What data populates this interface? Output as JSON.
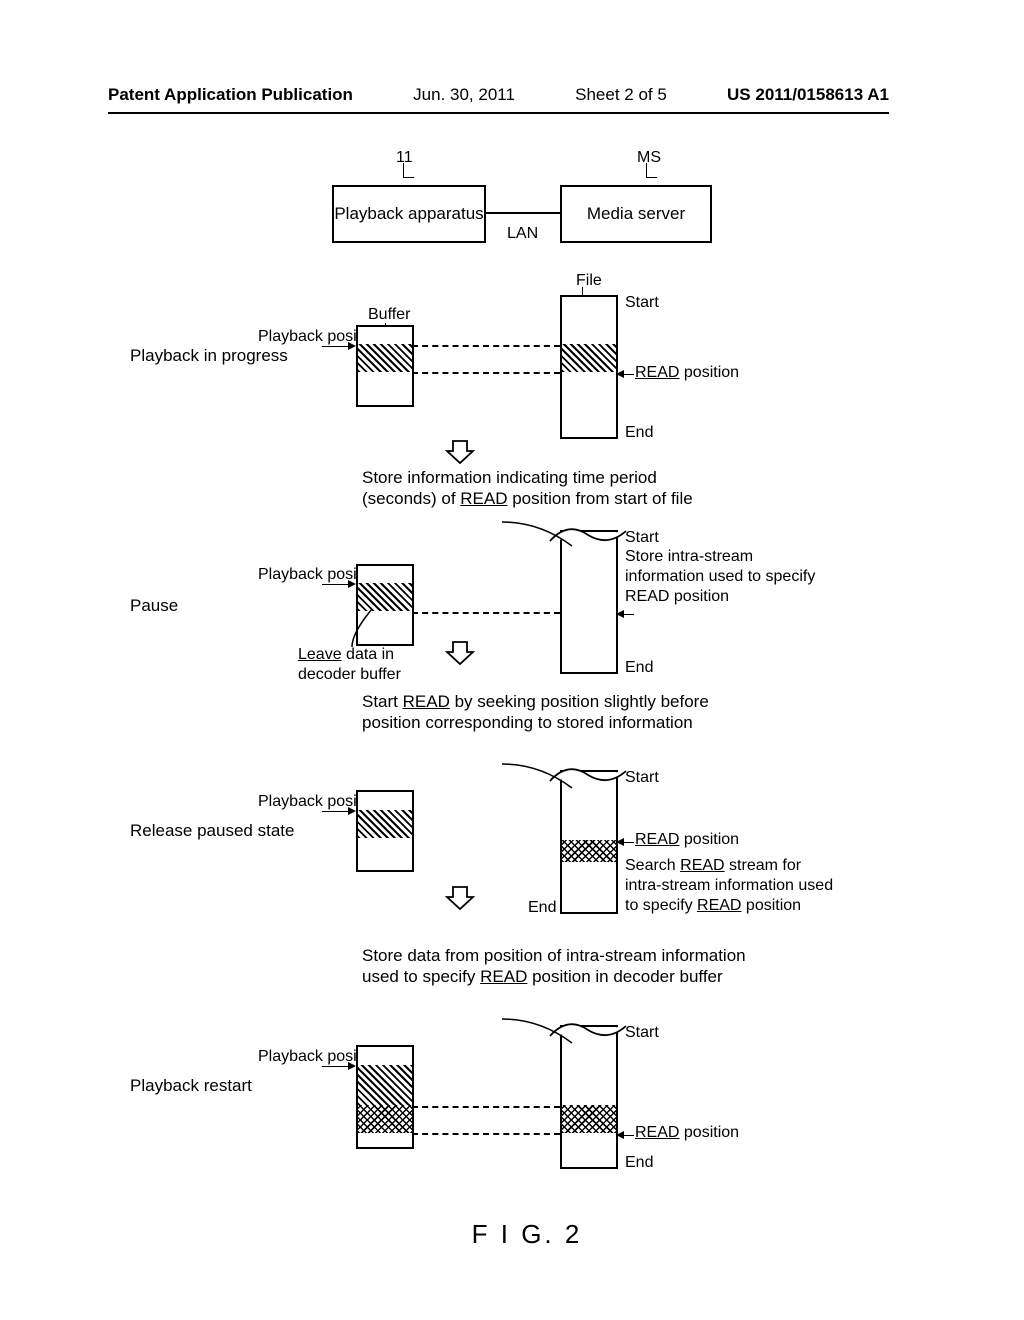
{
  "header": {
    "publication_type": "Patent Application Publication",
    "date": "Jun. 30, 2011",
    "sheet": "Sheet 2 of 5",
    "pub_number": "US 2011/0158613 A1"
  },
  "top_boxes": {
    "playback_ref": "11",
    "playback_label": "Playback apparatus",
    "server_ref": "MS",
    "server_label": "Media server",
    "lan": "LAN"
  },
  "stages": {
    "s1": {
      "label": "Playback in progress",
      "playback_position": "Playback position",
      "buffer": "Buffer",
      "file": "File",
      "start": "Start",
      "read": "READ position",
      "end": "End"
    },
    "caption1": "Store information indicating time period (seconds) of READ position from start of file",
    "s2": {
      "label": "Pause",
      "playback_position": "Playback position",
      "start": "Start",
      "note1": "Store intra-stream information used to specify READ position",
      "end": "End",
      "leave": "Leave data in decoder buffer"
    },
    "caption2": "Start READ by seeking position slightly before position corresponding to stored information",
    "s3": {
      "label": "Release paused state",
      "playback_position": "Playback position",
      "start": "Start",
      "read": "READ position",
      "end": "End",
      "note1": "Search READ stream for intra-stream information used to specify READ position"
    },
    "caption3": "Store data from position of intra-stream information used to specify READ position in decoder buffer",
    "s4": {
      "label": "Playback restart",
      "playback_position": "Playback position",
      "start": "Start",
      "read": "READ position",
      "end": "End"
    }
  },
  "figure_label": "F I G. 2"
}
